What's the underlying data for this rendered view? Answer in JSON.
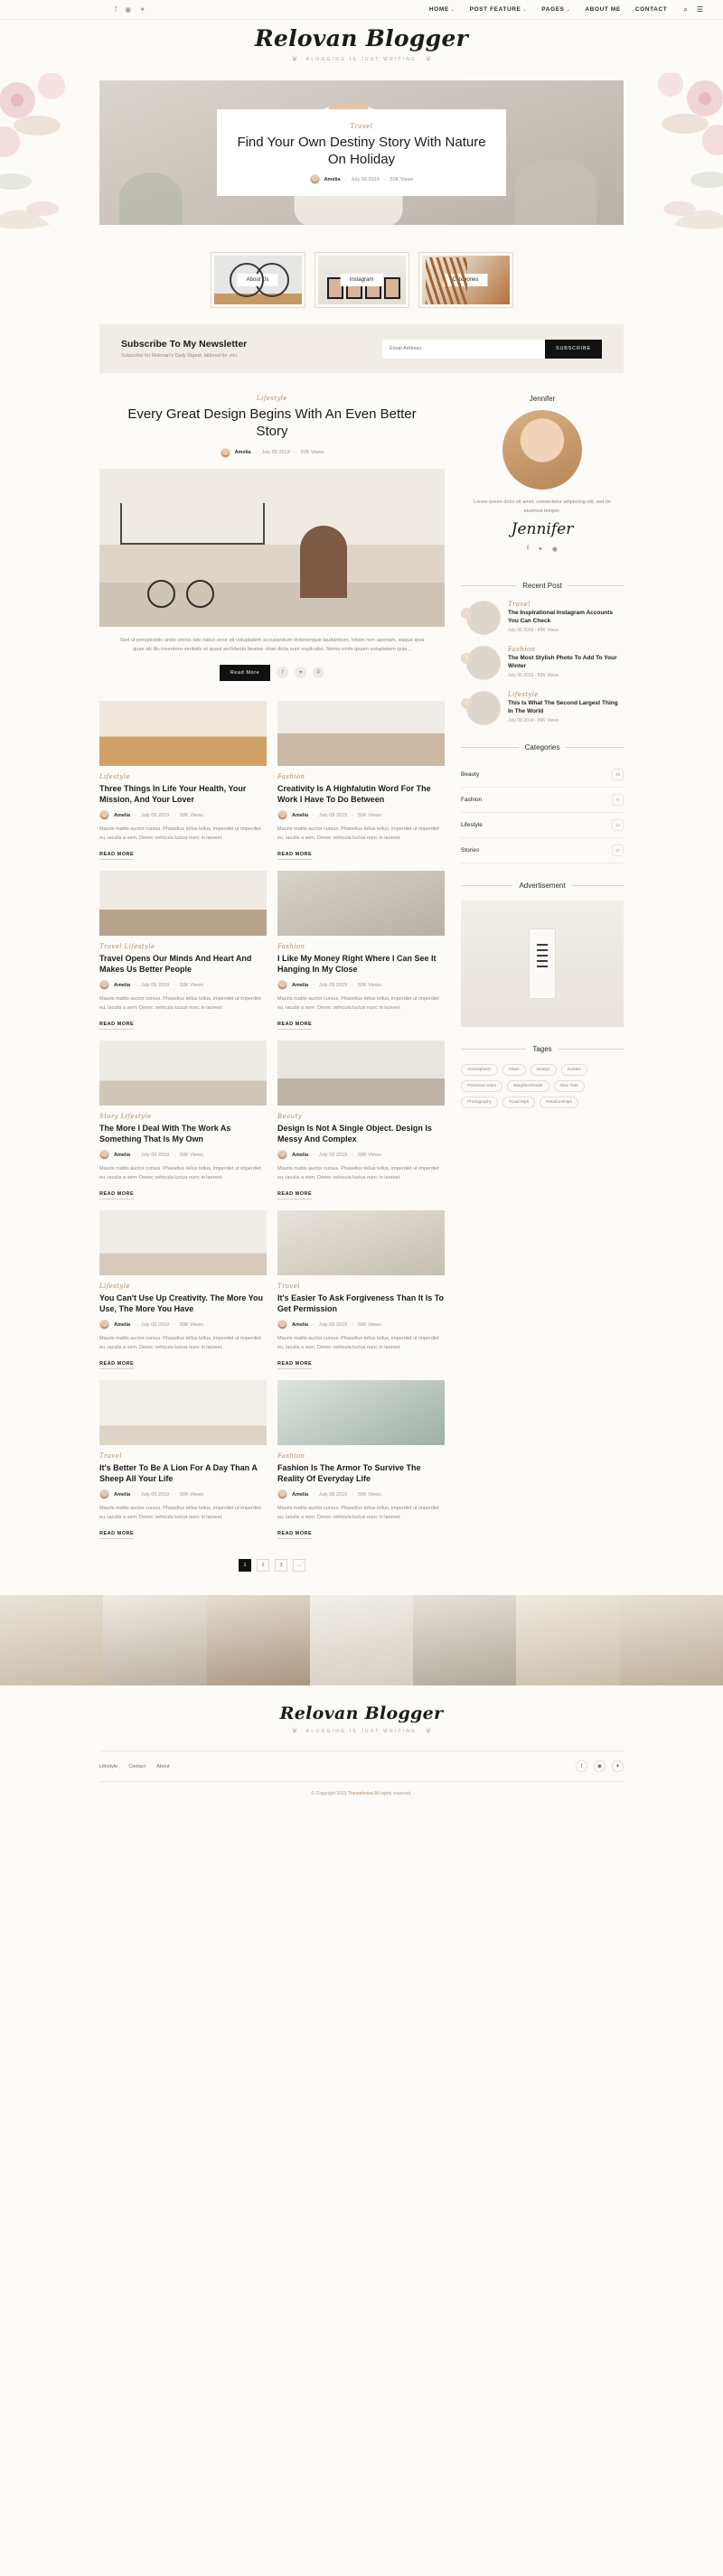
{
  "topbar": {
    "social": [
      {
        "name": "facebook-icon",
        "glyph": "f"
      },
      {
        "name": "instagram-icon",
        "glyph": "◉"
      },
      {
        "name": "twitter-icon",
        "glyph": "✦"
      }
    ],
    "nav": [
      {
        "label": "HOME",
        "caret": "⌄"
      },
      {
        "label": "POST FEATURE",
        "caret": "⌄"
      },
      {
        "label": "PAGES",
        "caret": "⌄"
      },
      {
        "label": "ABOUT ME",
        "caret": ""
      },
      {
        "label": "CONTACT",
        "caret": ""
      }
    ],
    "tools": [
      {
        "name": "search-icon",
        "glyph": "⌕"
      },
      {
        "name": "menu-icon",
        "glyph": "☰"
      }
    ]
  },
  "brand": {
    "logo": "Relovan Blogger",
    "tagline": "BLOGGING IS JUST WRITING"
  },
  "hero": {
    "category": "Travel",
    "title": "Find Your Own Destiny Story With Nature On Holiday",
    "author": "Amelia",
    "date": "July 09 2019",
    "views": "50K Views"
  },
  "feature_boxes": [
    {
      "label": "About Us"
    },
    {
      "label": "Instagram"
    },
    {
      "label": "Categories"
    }
  ],
  "newsletter": {
    "title": "Subscribe To My Newsletter",
    "subtitle": "Subscribe for Relovan's Daily Digest, tailored for you.",
    "placeholder": "Email Address",
    "button": "SUBSCRIBE"
  },
  "featured_post": {
    "category": "Lifestyle",
    "title": "Every Great Design Begins With An Even Better Story",
    "author": "Amelia",
    "date": "July 09 2019",
    "views": "50K Views",
    "excerpt": "Sed ut perspiciatis unde omnis iste natus error sit voluptatem accusantium doloremque laudantium, totam rem aperiam, eaque ipsa quae ab illo inventore veritatis et quasi architecto beatae vitae dicta sunt explicabo. Nemo enim ipsam voluptatem quia...",
    "read_more": "Read More",
    "share": [
      {
        "name": "facebook-icon",
        "glyph": "f"
      },
      {
        "name": "twitter-icon",
        "glyph": "✦"
      },
      {
        "name": "pinterest-icon",
        "glyph": "P"
      }
    ]
  },
  "posts": [
    {
      "category": "Lifestyle",
      "title": "Three Things In Life Your Health, Your Mission, And Your Lover",
      "author": "Amelia",
      "date": "July 09 2019",
      "views": "50K Views",
      "desc": "Mauris mattis auctor cursus. Phasellus tellus tellus, imperdiet ut imperdiet eu, iaculis a sem. Donec vehicula luctus nunc in laoreet.",
      "read_more": "READ MORE",
      "thumb": "t1"
    },
    {
      "category": "Fashion",
      "title": "Creativity Is A Highfalutin Word For The Work I Have To Do Between",
      "author": "Amelia",
      "date": "July 09 2019",
      "views": "50K Views",
      "desc": "Mauris mattis auctor cursus. Phasellus tellus tellus, imperdiet ut imperdiet eu, iaculis a sem. Donec vehicula luctus nunc in laoreet.",
      "read_more": "READ MORE",
      "thumb": "t2"
    },
    {
      "category": "Travel  Lifestyle",
      "title": "Travel Opens Our Minds And Heart And Makes Us Better People",
      "author": "Amelia",
      "date": "July 09 2019",
      "views": "50K Views",
      "desc": "Mauris mattis auctor cursus. Phasellus tellus tellus, imperdiet ut imperdiet eu, iaculis a sem. Donec vehicula luctus nunc in laoreet.",
      "read_more": "READ MORE",
      "thumb": "t3"
    },
    {
      "category": "Fashion",
      "title": "I Like My Money Right Where I Can See It Hanging In My Close",
      "author": "Amelia",
      "date": "July 09 2019",
      "views": "50K Views",
      "desc": "Mauris mattis auctor cursus. Phasellus tellus tellus, imperdiet ut imperdiet eu, iaculis a sem. Donec vehicula luctus nunc in laoreet.",
      "read_more": "READ MORE",
      "thumb": "t4"
    },
    {
      "category": "Story  Lifestyle",
      "title": "The More I Deal With The Work As Something That Is My Own",
      "author": "Amelia",
      "date": "July 09 2019",
      "views": "50K Views",
      "desc": "Mauris mattis auctor cursus. Phasellus tellus tellus, imperdiet ut imperdiet eu, iaculis a sem. Donec vehicula luctus nunc in laoreet.",
      "read_more": "READ MORE",
      "thumb": "t5"
    },
    {
      "category": "Beauty",
      "title": "Design Is Not A Single Object. Design Is Messy And Complex",
      "author": "Amelia",
      "date": "July 09 2019",
      "views": "50K Views",
      "desc": "Mauris mattis auctor cursus. Phasellus tellus tellus, imperdiet ut imperdiet eu, iaculis a sem. Donec vehicula luctus nunc in laoreet.",
      "read_more": "READ MORE",
      "thumb": "t6"
    },
    {
      "category": "Lifestyle",
      "title": "You Can't Use Up Creativity. The More You Use, The More You Have",
      "author": "Amelia",
      "date": "July 09 2019",
      "views": "50K Views",
      "desc": "Mauris mattis auctor cursus. Phasellus tellus tellus, imperdiet ut imperdiet eu, iaculis a sem. Donec vehicula luctus nunc in laoreet.",
      "read_more": "READ MORE",
      "thumb": "t7"
    },
    {
      "category": "Travel",
      "title": "It's Easier To Ask Forgiveness Than It Is To Get Permission",
      "author": "Amelia",
      "date": "July 09 2019",
      "views": "50K Views",
      "desc": "Mauris mattis auctor cursus. Phasellus tellus tellus, imperdiet ut imperdiet eu, iaculis a sem. Donec vehicula luctus nunc in laoreet.",
      "read_more": "READ MORE",
      "thumb": "t8"
    },
    {
      "category": "Travel",
      "title": "It's Better To Be A Lion For A Day Than A Sheep All Your Life",
      "author": "Amelia",
      "date": "July 09 2019",
      "views": "50K Views",
      "desc": "Mauris mattis auctor cursus. Phasellus tellus tellus, imperdiet ut imperdiet eu, iaculis a sem. Donec vehicula luctus nunc in laoreet.",
      "read_more": "READ MORE",
      "thumb": "t9"
    },
    {
      "category": "Fashion",
      "title": "Fashion Is The Armor To Survive The Reality Of Everyday Life",
      "author": "Amelia",
      "date": "July 09 2019",
      "views": "50K Views",
      "desc": "Mauris mattis auctor cursus. Phasellus tellus tellus, imperdiet ut imperdiet eu, iaculis a sem. Donec vehicula luctus nunc in laoreet.",
      "read_more": "READ MORE",
      "thumb": "t10"
    }
  ],
  "pagination": [
    {
      "label": "1",
      "active": true
    },
    {
      "label": "2",
      "active": false
    },
    {
      "label": "3",
      "active": false
    },
    {
      "label": "→",
      "active": false
    }
  ],
  "sidebar": {
    "author": {
      "name": "Jennifer",
      "bio": "Lorem ipsum dolor sit amet, consectetur adipiscing elit, sed do eiusmod tempor.",
      "signature": "Jennifer",
      "social": [
        {
          "name": "facebook-icon",
          "glyph": "f"
        },
        {
          "name": "twitter-icon",
          "glyph": "✦"
        },
        {
          "name": "instagram-icon",
          "glyph": "◉"
        }
      ]
    },
    "recent_title": "Recent Post",
    "recent_posts": [
      {
        "num": "1",
        "category": "Travel",
        "title": "The Inspirational Instagram Accounts You Can Check",
        "meta": "July 09 2019  -  89K Views"
      },
      {
        "num": "2",
        "category": "Fashion",
        "title": "The Most Stylish Photo To Add To Your Winter",
        "meta": "July 09 2019  -  89K Views"
      },
      {
        "num": "3",
        "category": "Lifestyle",
        "title": "This Is What The Second Largest Thing In The World",
        "meta": "July 09 2019  -  89K Views"
      }
    ],
    "categories_title": "Categories",
    "categories": [
      {
        "label": "Beauty",
        "count": "19"
      },
      {
        "label": "Fashion",
        "count": "9"
      },
      {
        "label": "Lifestyle",
        "count": "12"
      },
      {
        "label": "Stories",
        "count": "17"
      }
    ],
    "ad_title": "Advertisement",
    "tags_title": "Tages",
    "tags": [
      "Atmospheric",
      "Cities",
      "Design",
      "Guides",
      "Personal notes",
      "Neighborhoods",
      "New York",
      "Photography",
      "Road trips",
      "Relationships"
    ]
  },
  "footer": {
    "links": [
      "Lifestyle",
      "Contact",
      "About"
    ],
    "social": [
      {
        "name": "facebook-icon",
        "glyph": "f"
      },
      {
        "name": "instagram-icon",
        "glyph": "◉"
      },
      {
        "name": "twitter-icon",
        "glyph": "✦"
      }
    ],
    "copyright_pre": "© Copyright 2019 ",
    "copyright_brand": "Themeforest",
    "copyright_post": " All rights reserved."
  }
}
